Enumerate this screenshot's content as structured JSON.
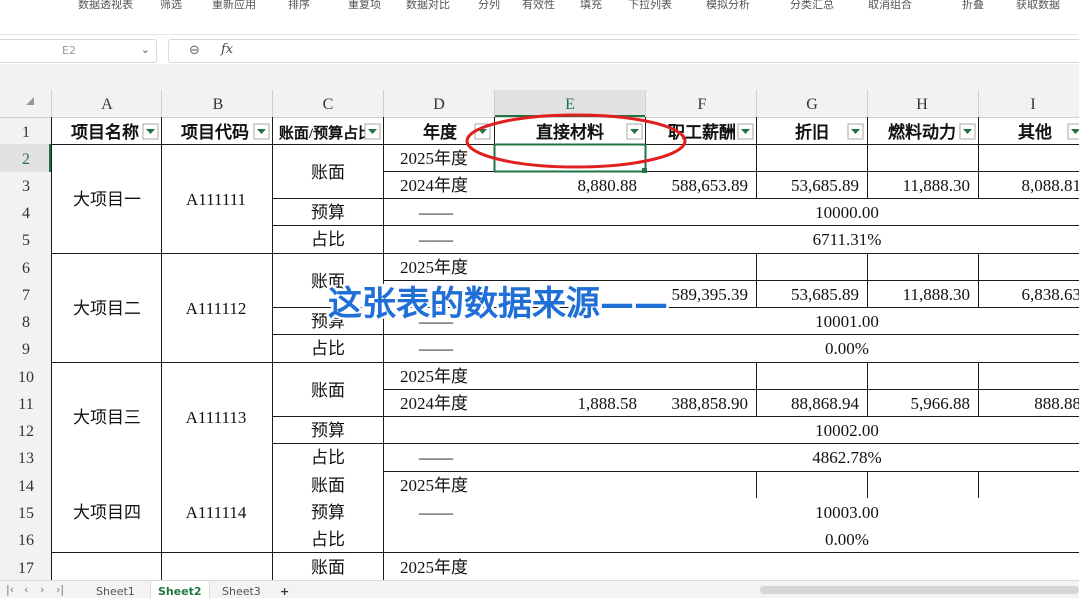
{
  "toolbar": {
    "items": [
      "数据透视表",
      "筛选",
      "重新应用",
      "排序",
      "重复项",
      "数据对比",
      "分列",
      "有效性",
      "填充",
      "下拉列表",
      "模拟分析",
      "分类汇总",
      "取消组合",
      "折叠",
      "获取数据"
    ]
  },
  "namebox": {
    "value": "E2"
  },
  "formula": {
    "zoom_icon": "zoom-icon",
    "fx_label": "fx",
    "value": ""
  },
  "columns": [
    {
      "letter": "",
      "header": ""
    },
    {
      "letter": "A",
      "header": "项目名称"
    },
    {
      "letter": "B",
      "header": "项目代码"
    },
    {
      "letter": "C",
      "header": "账面/预算占比"
    },
    {
      "letter": "D",
      "header": "年度"
    },
    {
      "letter": "E",
      "header": "直接材料"
    },
    {
      "letter": "F",
      "header": "职工薪酬"
    },
    {
      "letter": "G",
      "header": "折旧"
    },
    {
      "letter": "H",
      "header": "燃料动力"
    },
    {
      "letter": "I",
      "header": "其他"
    }
  ],
  "row_numbers": [
    "1",
    "2",
    "3",
    "4",
    "5",
    "6",
    "7",
    "8",
    "9",
    "10",
    "11",
    "12",
    "13",
    "14",
    "15",
    "16",
    "17"
  ],
  "projects": [
    {
      "name": "大项目一",
      "code": "A111111"
    },
    {
      "name": "大项目二",
      "code": "A111112"
    },
    {
      "name": "大项目三",
      "code": "A111113"
    },
    {
      "name": "大项目四",
      "code": "A111114"
    }
  ],
  "labels": {
    "book": "账面",
    "budget": "预算",
    "ratio": "占比",
    "dash": "——"
  },
  "years": {
    "y2025": "2025年度",
    "y2024": "2024年度"
  },
  "values": {
    "r3": [
      "8,880.88",
      "588,653.89",
      "53,685.89",
      "11,888.30",
      "8,088.81"
    ],
    "r4": "10000.00",
    "r5": "6711.31%",
    "r7": [
      "",
      "589,395.39",
      "53,685.89",
      "11,888.30",
      "6,838.63"
    ],
    "r8": "10001.00",
    "r9": "0.00%",
    "r11": [
      "1,888.58",
      "388,858.90",
      "88,868.94",
      "5,966.88",
      "888.88"
    ],
    "r12": "10002.00",
    "r13": "4862.78%",
    "r15": "10003.00",
    "r16": "0.00%"
  },
  "overlay_caption": "这张表的数据来源——",
  "sheets": [
    "Sheet1",
    "Sheet2",
    "Sheet3"
  ],
  "add_sheet": "+",
  "colors": {
    "accent": "#217346",
    "caption": "#1f6fd6",
    "annotation": "#e02020"
  }
}
